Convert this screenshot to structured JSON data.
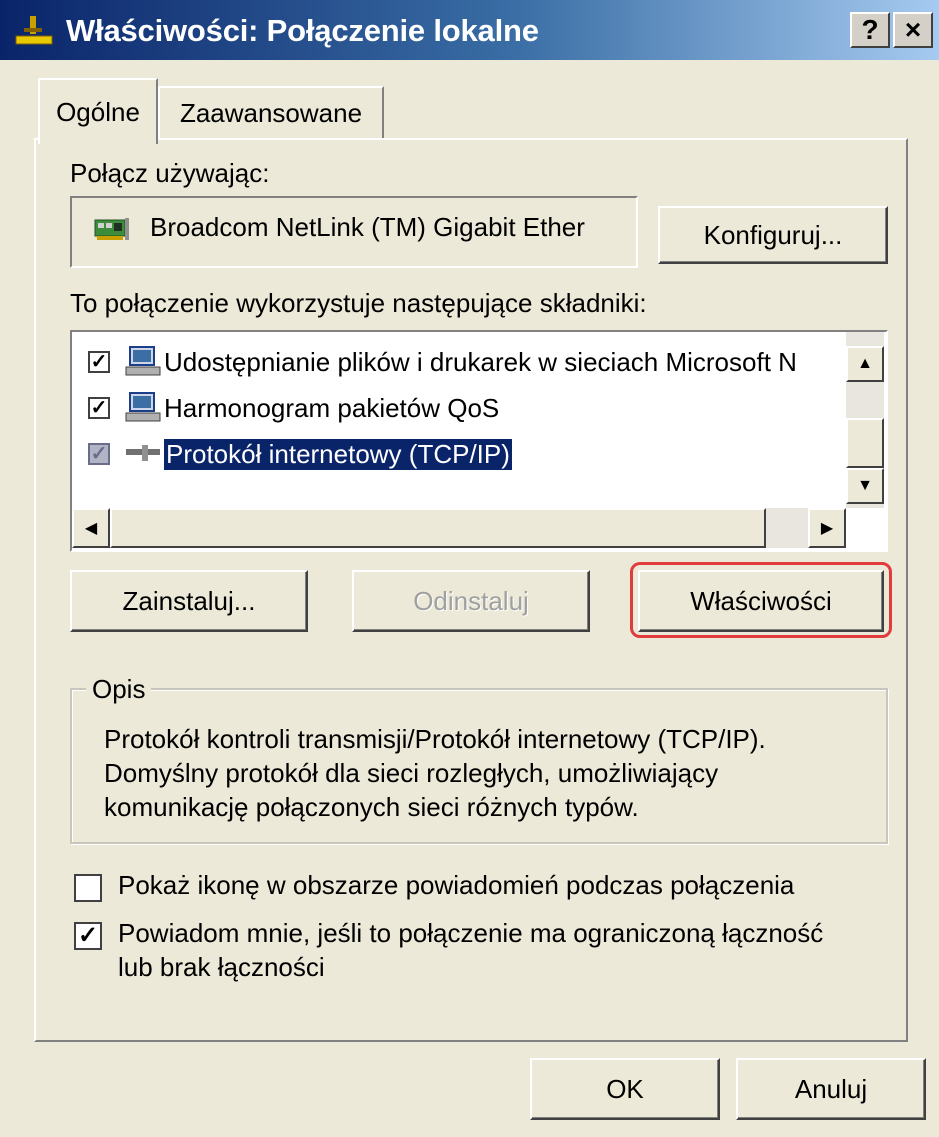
{
  "window": {
    "title": "Właściwości: Połączenie lokalne",
    "help_label": "?",
    "close_label": "×"
  },
  "tabs": [
    {
      "label": "Ogólne",
      "selected": true
    },
    {
      "label": "Zaawansowane",
      "selected": false
    }
  ],
  "connect_using": {
    "label": "Połącz używając:",
    "adapter_name": "Broadcom NetLink (TM) Gigabit Ether",
    "configure_label": "Konfiguruj..."
  },
  "components": {
    "label": "To połączenie wykorzystuje następujące składniki:",
    "items": [
      {
        "label": "Udostępnianie plików i drukarek w sieciach Microsoft N",
        "checked": true,
        "selected": false,
        "icon": "network-service-icon"
      },
      {
        "label": "Harmonogram pakietów QoS",
        "checked": true,
        "selected": false,
        "icon": "network-service-icon"
      },
      {
        "label": "Protokół internetowy (TCP/IP)",
        "checked": true,
        "selected": true,
        "icon": "protocol-icon"
      }
    ]
  },
  "buttons": {
    "install": "Zainstaluj...",
    "uninstall": "Odinstaluj",
    "properties": "Właściwości",
    "ok": "OK",
    "cancel": "Anuluj"
  },
  "description": {
    "title": "Opis",
    "lines": [
      "Protokół kontroli transmisji/Protokół internetowy (TCP/IP).",
      "Domyślny protokół dla sieci rozległych, umożliwiający",
      "komunikację połączonych sieci różnych typów."
    ]
  },
  "options": {
    "show_icon": {
      "label": "Pokaż ikonę w obszarze powiadomień podczas połączenia",
      "checked": false
    },
    "notify": {
      "label_line1": "Powiadom mnie, jeśli to połączenie ma ograniczoną łączność",
      "label_line2": "lub brak łączności",
      "checked": true
    }
  },
  "colors": {
    "highlight_outline": "#e03c3c",
    "selection": "#0a246a",
    "titlebar_start": "#0a246a"
  }
}
